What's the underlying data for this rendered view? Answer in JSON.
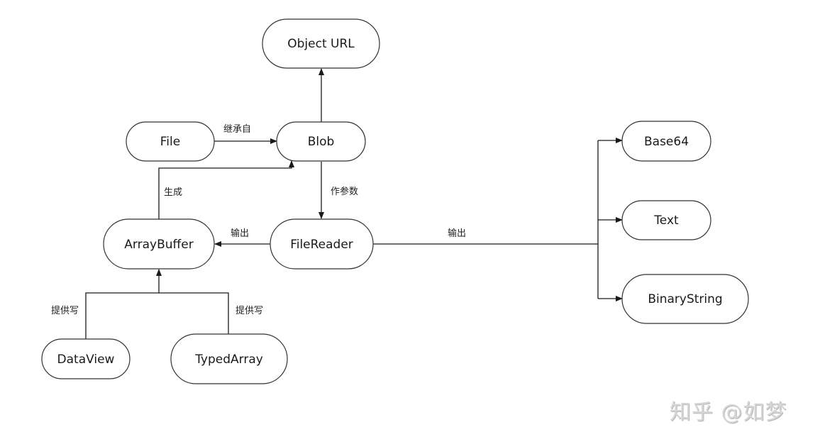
{
  "diagram": {
    "title": "",
    "nodes": {
      "object_url": "Object URL",
      "file": "File",
      "blob": "Blob",
      "array_buffer": "ArrayBuffer",
      "file_reader": "FileReader",
      "data_view": "DataView",
      "typed_array": "TypedArray",
      "base64": "Base64",
      "text": "Text",
      "binary_string": "BinaryString"
    },
    "edges": [
      {
        "from": "Blob",
        "to": "Object URL",
        "label": ""
      },
      {
        "from": "File",
        "to": "Blob",
        "label": "继承自"
      },
      {
        "from": "ArrayBuffer",
        "to": "Blob",
        "label": "生成"
      },
      {
        "from": "Blob",
        "to": "FileReader",
        "label": "作参数"
      },
      {
        "from": "FileReader",
        "to": "ArrayBuffer",
        "label": "输出"
      },
      {
        "from": "FileReader",
        "to": [
          "Base64",
          "Text",
          "BinaryString"
        ],
        "label": "输出"
      },
      {
        "from": "DataView",
        "to": "ArrayBuffer",
        "label": "提供写"
      },
      {
        "from": "TypedArray",
        "to": "ArrayBuffer",
        "label": "提供写"
      }
    ],
    "edge_labels": {
      "inherits": "继承自",
      "generates": "生成",
      "as_param": "作参数",
      "output_left": "输出",
      "output_right": "输出",
      "provide_write_left": "提供写",
      "provide_write_right": "提供写"
    }
  },
  "watermark": "知乎 @如梦"
}
